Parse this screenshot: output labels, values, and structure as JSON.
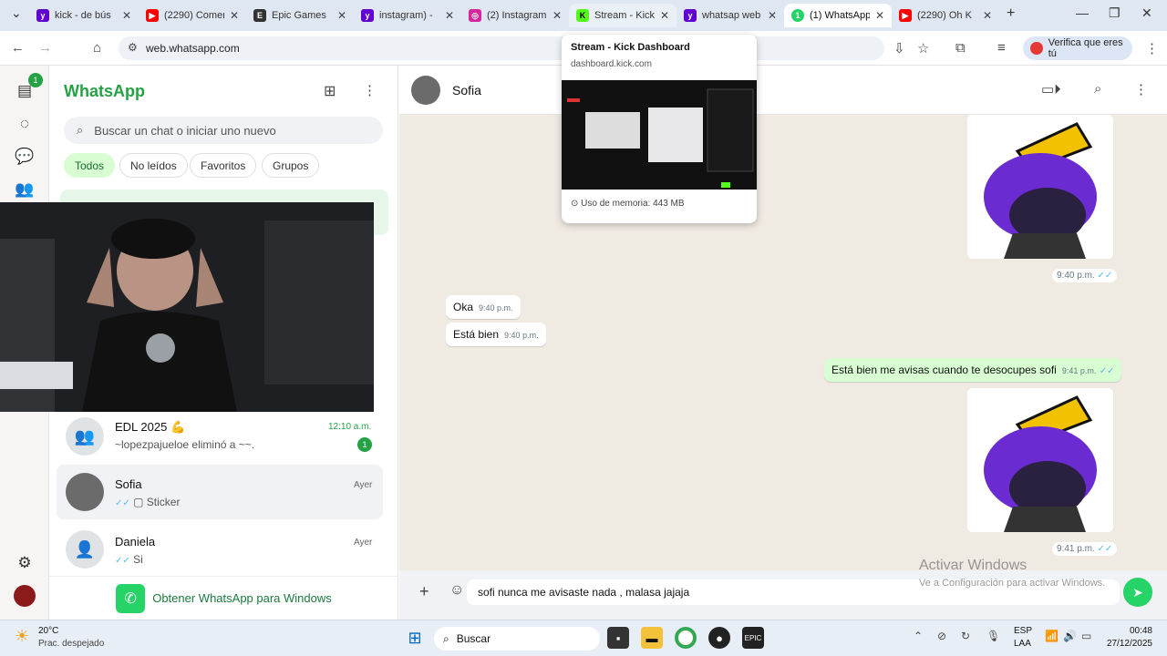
{
  "browser": {
    "tabs": [
      {
        "title": "kick - de bús",
        "favicon": "yahoo-icon",
        "color": "#6001d2"
      },
      {
        "title": "(2290) Comen",
        "favicon": "youtube-icon",
        "color": "#ff0000"
      },
      {
        "title": "Epic Games",
        "favicon": "epic-icon",
        "color": "#333333"
      },
      {
        "title": "instagram) -",
        "favicon": "yahoo-icon",
        "color": "#6001d2"
      },
      {
        "title": "(2) Instagram",
        "favicon": "instagram-icon",
        "color": "#d6249f"
      },
      {
        "title": "Stream - Kick",
        "favicon": "kick-icon",
        "color": "#53fc18"
      },
      {
        "title": "whatsap web",
        "favicon": "yahoo-icon",
        "color": "#6001d2"
      },
      {
        "title": "(1) WhatsApp",
        "favicon": "whatsapp-icon",
        "color": "#25d366"
      },
      {
        "title": "(2290) Oh K",
        "favicon": "youtube-icon",
        "color": "#ff0000"
      }
    ],
    "url": "web.whatsapp.com",
    "verify_label": "Verifica que eres tú",
    "preview": {
      "title": "Stream - Kick Dashboard",
      "domain": "dashboard.kick.com",
      "memory": "Uso de memoria: 443 MB"
    }
  },
  "whatsapp": {
    "title": "WhatsApp",
    "rail_badge": "1",
    "search_placeholder": "Buscar un chat o iniciar uno nuevo",
    "filters": [
      "Todos",
      "No leídos",
      "Favoritos",
      "Grupos"
    ],
    "chats": [
      {
        "name": "EDL 2025 💪",
        "last": "~lopezpajueloe eliminó a ~~.",
        "time": "12:10 a.m.",
        "unread": "1"
      },
      {
        "name": "Sofia",
        "last": "Sticker",
        "time": "Ayer"
      },
      {
        "name": "Daniela",
        "last": "Si",
        "time": "Ayer"
      }
    ],
    "get_app": "Obtener WhatsApp para Windows",
    "active_chat": {
      "name": "Sofia",
      "messages": [
        {
          "type": "sticker",
          "dir": "out",
          "time": "9:40 p.m."
        },
        {
          "type": "text",
          "dir": "in",
          "text": "Oka",
          "time": "9:40 p.m."
        },
        {
          "type": "text",
          "dir": "in",
          "text": "Está bien",
          "time": "9:40 p.m."
        },
        {
          "type": "text",
          "dir": "out",
          "text": "Está bien me avisas cuando te desocupes sofi",
          "time": "9:41 p.m."
        },
        {
          "type": "sticker",
          "dir": "out",
          "time": "9:41 p.m."
        }
      ],
      "draft": "sofi nunca me avisaste nada , malasa jajaja"
    },
    "activate_windows": "Activar Windows",
    "activate_windows_sub": "Ve a Configuración para activar Windows."
  },
  "taskbar": {
    "weather_temp": "20°C",
    "weather_desc": "Prac. despejado",
    "search": "Buscar",
    "lang": "ESP",
    "lang2": "LAA",
    "time": "00:48",
    "date": "27/12/2025"
  },
  "colors": {
    "accent": "#25a244",
    "outgoing": "#d9fdd3",
    "chatbg": "#efeae2"
  }
}
